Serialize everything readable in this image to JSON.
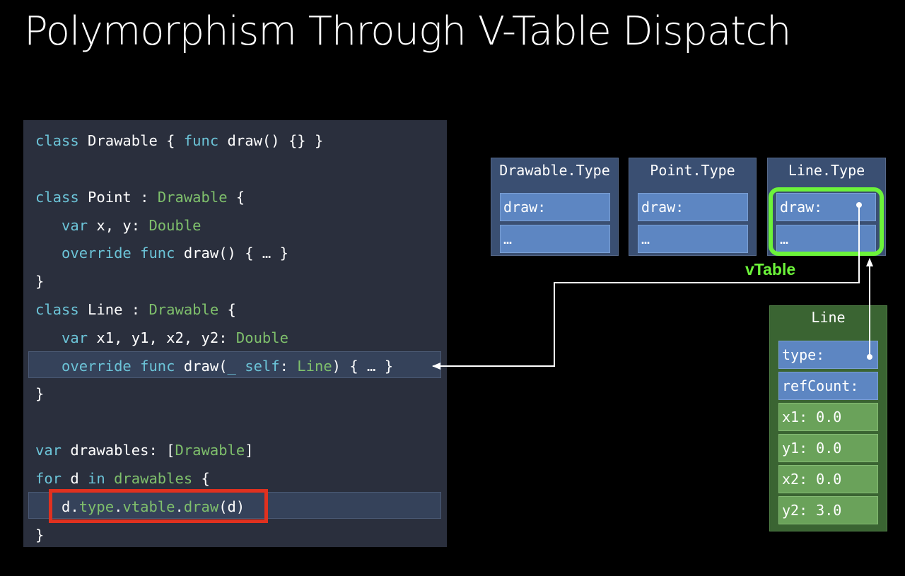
{
  "title": "Polymorphism Through V-Table Dispatch",
  "code": {
    "l1": {
      "t1": "class",
      "t2": " Drawable { ",
      "t3": "func",
      "t4": " draw() {} }"
    },
    "l3": {
      "t1": "class",
      "t2": " Point : ",
      "t3": "Drawable",
      "t4": " {"
    },
    "l4": {
      "t1": "   var",
      "t2": " x, y: ",
      "t3": "Double"
    },
    "l5": {
      "t1": "   override func",
      "t2": " draw() { … }"
    },
    "l6": {
      "t1": "}"
    },
    "l7": {
      "t1": "class",
      "t2": " Line : ",
      "t3": "Drawable",
      "t4": " {"
    },
    "l8": {
      "t1": "   var",
      "t2": " x1, y1, x2, y2: ",
      "t3": "Double"
    },
    "l9": {
      "t1": "   override func",
      "t2": " draw(",
      "t3": "_ self",
      "t4": ": ",
      "t5": "Line",
      "t6": ") { … }"
    },
    "l10": {
      "t1": "}"
    },
    "l12": {
      "t1": "var",
      "t2": " drawables: [",
      "t3": "Drawable",
      "t4": "]"
    },
    "l13": {
      "t1": "for",
      "t2": " d ",
      "t3": "in",
      "t4": " drawables",
      "t5": " {"
    },
    "l14": {
      "t1": "   d.",
      "t2": "type",
      "t3": ".",
      "t4": "vtable",
      "t5": ".",
      "t6": "draw",
      "t7": "(d)"
    },
    "l15": {
      "t1": "}"
    }
  },
  "type_tables": [
    {
      "name": "Drawable.Type",
      "slots": [
        "draw:",
        "…"
      ]
    },
    {
      "name": "Point.Type",
      "slots": [
        "draw:",
        "…"
      ]
    },
    {
      "name": "Line.Type",
      "slots": [
        "draw:",
        "…"
      ]
    }
  ],
  "vtable_label": "vTable",
  "line_object": {
    "name": "Line",
    "fields": [
      "type:",
      "refCount:",
      "x1: 0.0",
      "y1: 0.0",
      "x2: 0.0",
      "y2: 3.0"
    ]
  },
  "colors": {
    "background": "#000000",
    "code_panel": "#2a2f3d",
    "keyword": "#6cc4d8",
    "type_name": "#7fc06c",
    "red_highlight": "#e0311f",
    "vtable_highlight": "#6cf33a",
    "slot_blue": "#5d86c2",
    "field_green": "#6aa25a"
  }
}
